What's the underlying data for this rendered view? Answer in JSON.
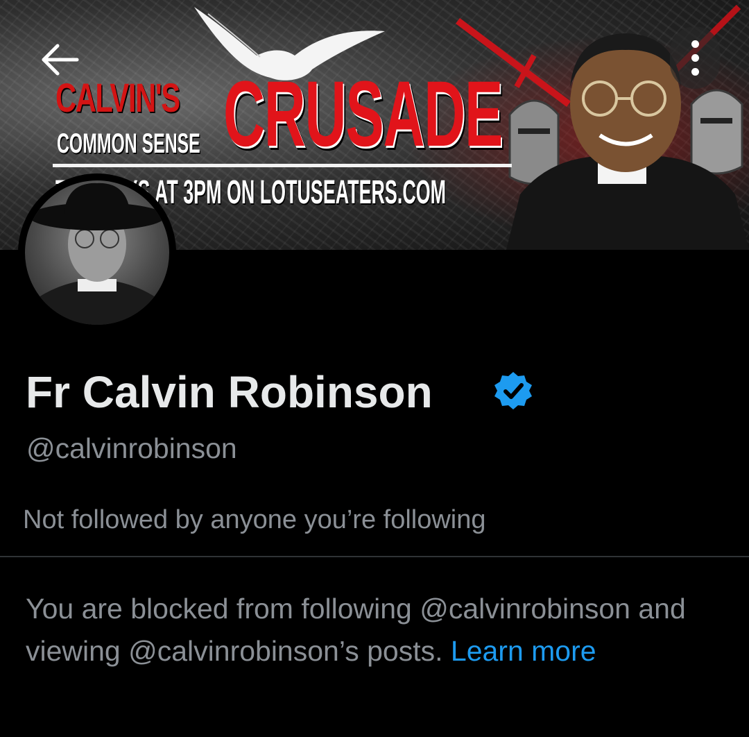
{
  "banner": {
    "title_small": "CALVIN'S",
    "title_sub": "COMMON SENSE",
    "title_main": "CRUSADE",
    "schedule": "T         AYS AT 3PM ON LOTUSEATERS.COM"
  },
  "profile": {
    "display_name": "Fr Calvin Robinson",
    "handle": "@calvinrobinson",
    "followers_note": "Not followed by anyone you’re following",
    "verified": true
  },
  "blocked": {
    "message": "You are blocked from following @calvinrobinson and viewing @calvinrobinson’s posts. ",
    "link_text": "Learn more"
  },
  "icons": {
    "back": "arrow-left-icon",
    "more": "more-vertical-icon",
    "verified": "verified-badge-icon"
  },
  "colors": {
    "background": "#000000",
    "text_primary": "#e7e9ea",
    "text_secondary": "#8b9096",
    "link": "#1d9bf0",
    "verified": "#1d9bf0",
    "banner_red": "#e1141a"
  }
}
